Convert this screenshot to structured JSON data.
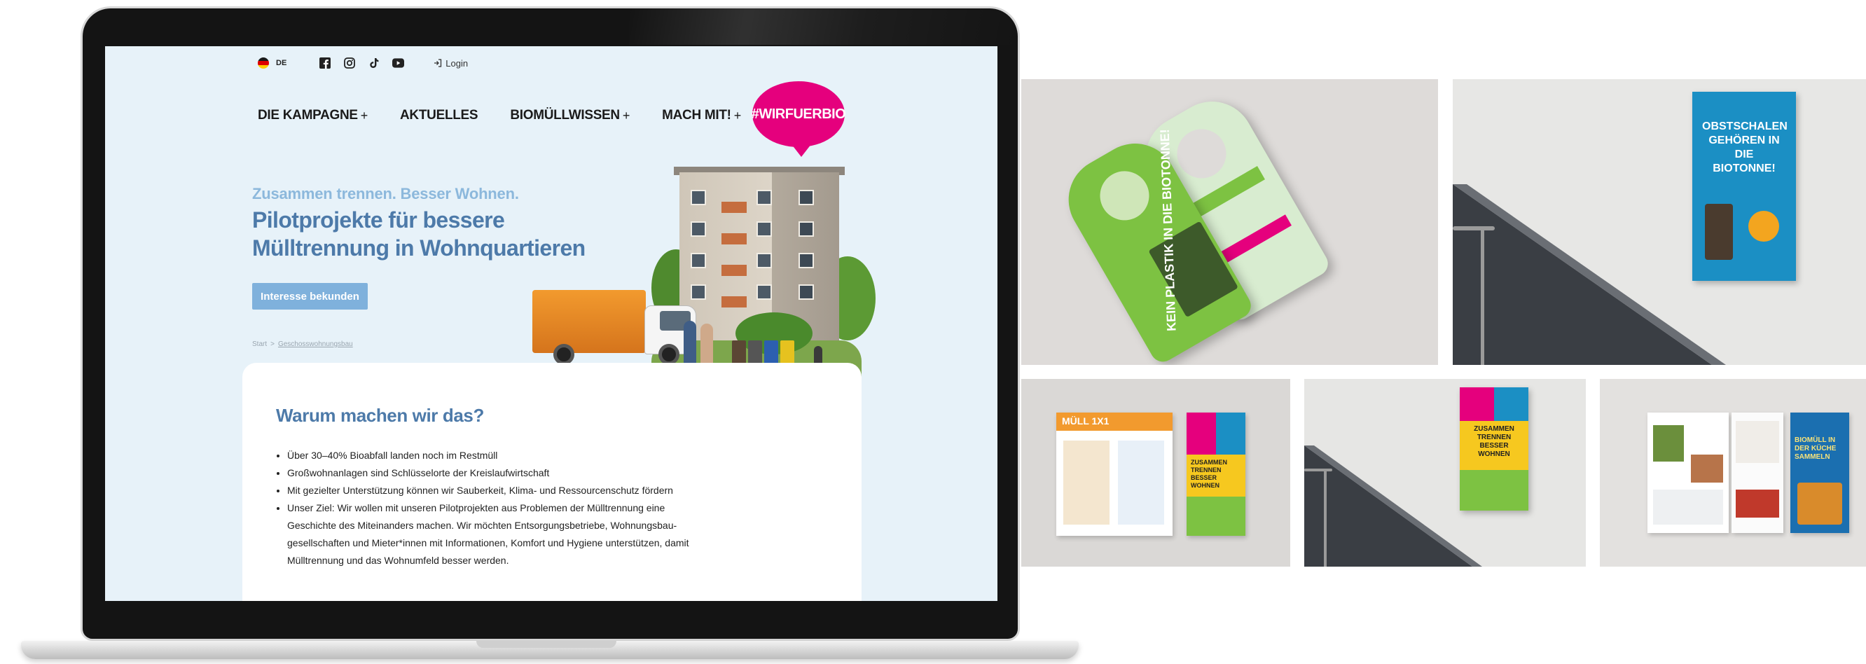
{
  "topbar": {
    "language": "DE",
    "login_label": "Login",
    "social_icons": [
      "facebook-icon",
      "instagram-icon",
      "tiktok-icon",
      "youtube-icon"
    ]
  },
  "nav": {
    "items": [
      {
        "label": "DIE KAMPAGNE",
        "has_submenu": true
      },
      {
        "label": "AKTUELLES",
        "has_submenu": false
      },
      {
        "label": "BIOMÜLLWISSEN",
        "has_submenu": true
      },
      {
        "label": "MACH MIT!",
        "has_submenu": true
      }
    ],
    "plus_symbol": "+"
  },
  "badge": {
    "label": "#WIRFUERBIO",
    "color": "#e5007d"
  },
  "hero": {
    "subtitle": "Zusammen trennen. Besser Wohnen.",
    "headline_line1": "Pilotprojekte für bessere",
    "headline_line2": "Mülltrennung in Wohnquartieren",
    "cta_label": "Interesse bekunden"
  },
  "breadcrumb": {
    "home": "Start",
    "separator": ">",
    "current": "Geschosswohnungsbau"
  },
  "content": {
    "title": "Warum machen wir das?",
    "bullets": [
      "Über 30–40% Bioabfall landen noch im Restmüll",
      "Großwohnanlagen sind Schlüsselorte der Kreislaufwirtschaft",
      "Mit gezielter Unterstützung können wir Sauberkeit, Klima- und Ressourcenschutz fördern",
      "Unser Ziel: Wir wollen mit unseren Pilotprojekten aus Problemen der Mülltrennung eine Geschichte des Miteinanders machen. Wir möchten Entsorgungsbetriebe, Wohnungsbau-gesellschaften und Mieter*innen mit Informationen, Komfort und Hygiene unterstützen, damit Mülltrennung und das Wohnumfeld besser werden."
    ]
  },
  "mockups": {
    "doorhanger_text": "KEIN PLASTIK IN DIE BIOTONNE!",
    "poster1_text": "OBSTSCHALEN GEHÖREN IN DIE BIOTONNE!",
    "brochure1_cover": "MÜLL 1X1",
    "brochure1_back": "ZUSAMMEN TRENNEN BESSER WOHNEN",
    "poster2_text": "ZUSAMMEN TRENNEN BESSER WOHNEN",
    "brochure2_cover": "BIOMÜLL IN DER KÜCHE SAMMELN"
  },
  "colors": {
    "brand_pink": "#e5007d",
    "headline_blue": "#4d7aa9",
    "subtitle_blue": "#8cb8dc",
    "button_blue": "#7fb1dc",
    "hero_background": "#e7f2f9",
    "campaign_green": "#7dc242",
    "poster_blue": "#1b8fc4"
  }
}
